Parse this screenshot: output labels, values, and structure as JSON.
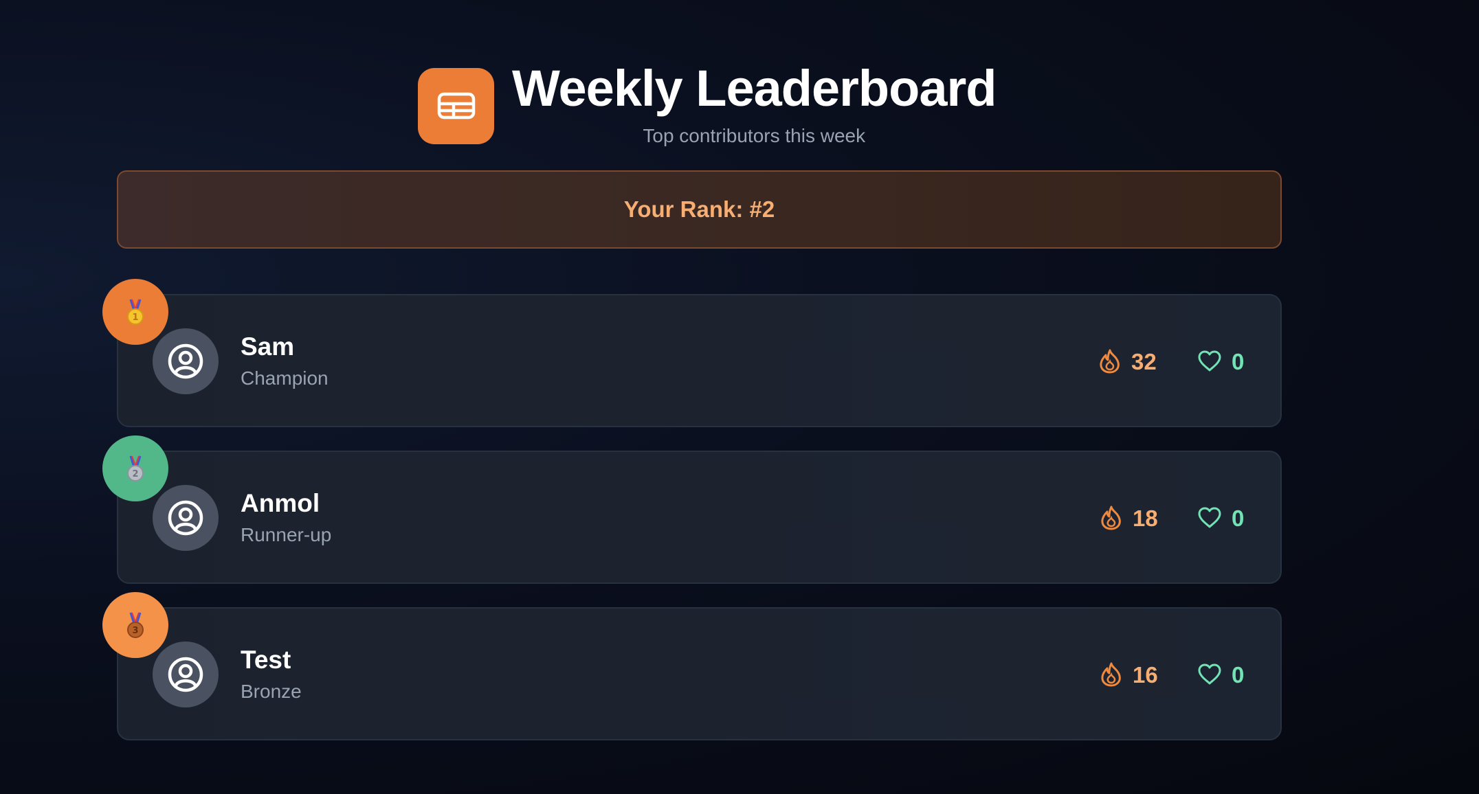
{
  "header": {
    "icon": "table-icon",
    "title": "Weekly Leaderboard",
    "subtitle": "Top contributors this week"
  },
  "rank_banner": {
    "text": "Your Rank: #2"
  },
  "colors": {
    "accent": "#ec7d36",
    "rank_text": "#f7ae72",
    "streak": "#f7ae72",
    "likes": "#72e3b4",
    "medal_1": "#ec7d36",
    "medal_2": "#52b88a",
    "medal_3": "#f4924a"
  },
  "leaderboard": [
    {
      "rank": 1,
      "medal_icon": "gold-medal-icon",
      "name": "Sam",
      "title": "Champion",
      "streak": "32",
      "likes": "0"
    },
    {
      "rank": 2,
      "medal_icon": "silver-medal-icon",
      "name": "Anmol",
      "title": "Runner-up",
      "streak": "18",
      "likes": "0"
    },
    {
      "rank": 3,
      "medal_icon": "bronze-medal-icon",
      "name": "Test",
      "title": "Bronze",
      "streak": "16",
      "likes": "0"
    }
  ]
}
